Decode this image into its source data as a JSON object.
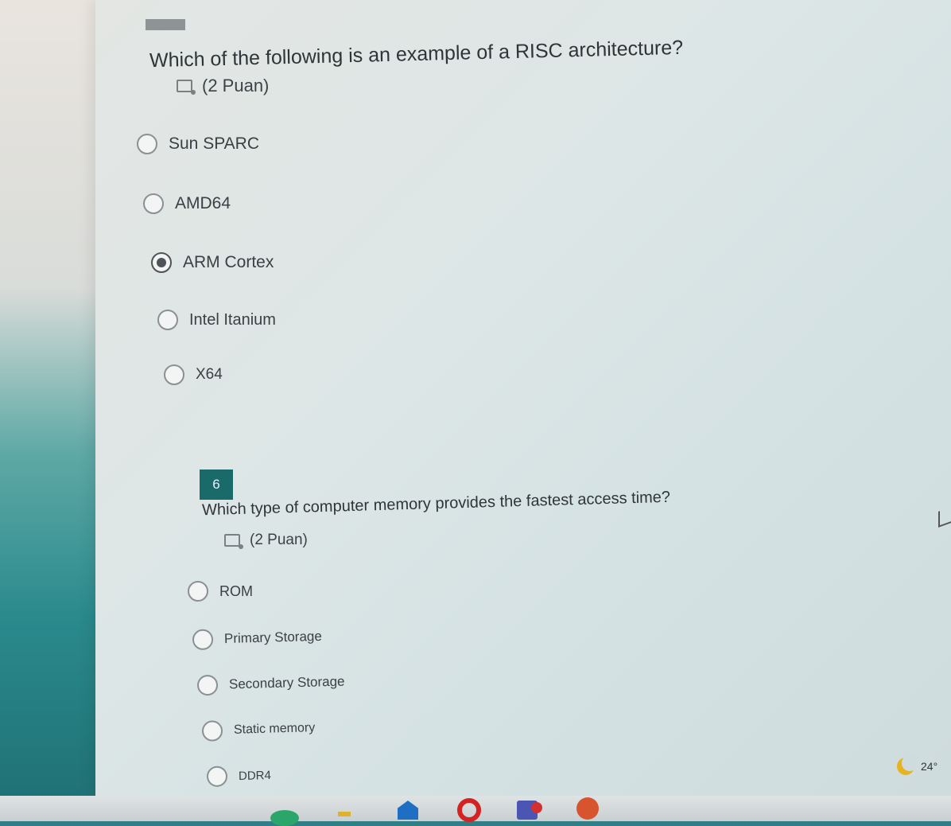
{
  "questions": [
    {
      "number": "",
      "title": "Which of the following is an example of a RISC architecture?",
      "points": "(2 Puan)",
      "options": [
        {
          "label": "Sun SPARC",
          "selected": false
        },
        {
          "label": "AMD64",
          "selected": false
        },
        {
          "label": "ARM Cortex",
          "selected": true
        },
        {
          "label": "Intel Itanium",
          "selected": false
        },
        {
          "label": "X64",
          "selected": false
        }
      ]
    },
    {
      "number": "6",
      "title": "Which type of computer memory provides the fastest access time?",
      "points": "(2 Puan)",
      "options": [
        {
          "label": "ROM",
          "selected": false
        },
        {
          "label": "Primary Storage",
          "selected": false
        },
        {
          "label": "Secondary Storage",
          "selected": false
        },
        {
          "label": "Static memory",
          "selected": false
        },
        {
          "label": "DDR4",
          "selected": false
        }
      ]
    }
  ],
  "taskbar": {
    "weather_temp": "24°",
    "icons": [
      "mail-icon",
      "opera-icon",
      "teams-icon",
      "app-icon"
    ]
  },
  "colors": {
    "question_badge": "#1a6a6a",
    "desktop_teal": "#2f7f86"
  }
}
